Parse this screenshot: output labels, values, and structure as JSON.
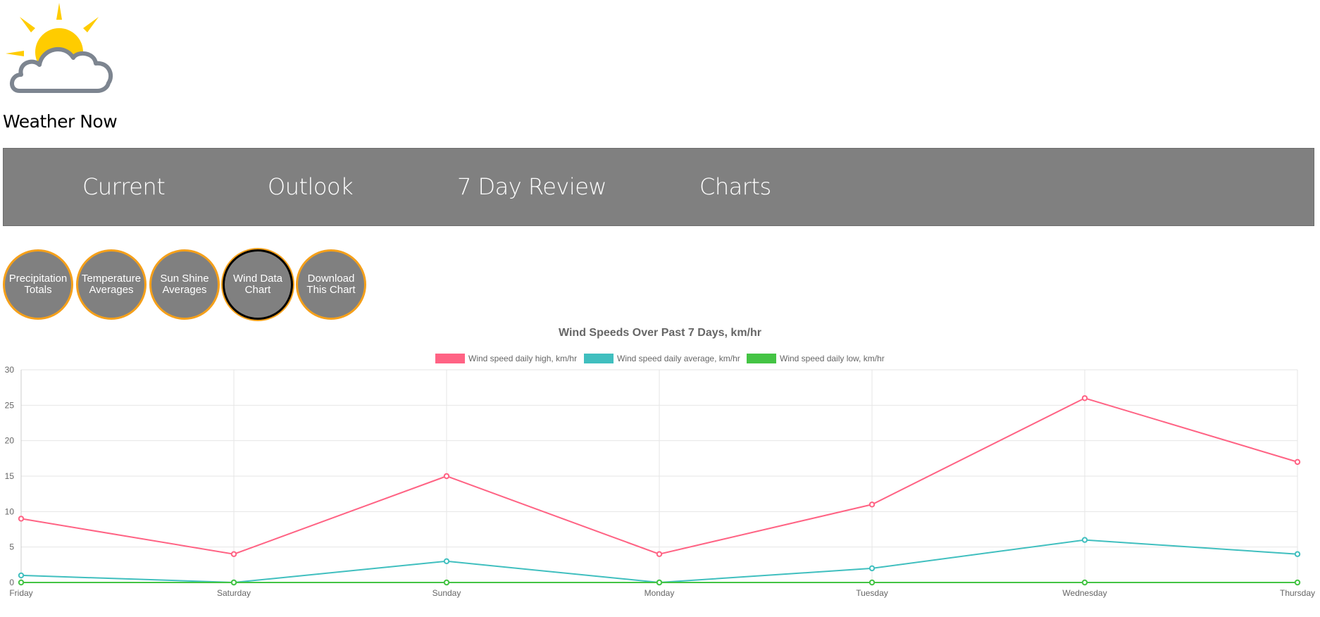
{
  "site": {
    "title": "Weather Now"
  },
  "logo": {
    "icon": "partly-cloudy-icon",
    "sun_color": "#ffcc00",
    "cloud_color": "#7d8590"
  },
  "nav": {
    "items": [
      {
        "label": "Current",
        "name": "nav-current"
      },
      {
        "label": "Outlook",
        "name": "nav-outlook"
      },
      {
        "label": "7 Day Review",
        "name": "nav-7-day-review"
      },
      {
        "label": "Charts",
        "name": "nav-charts"
      }
    ],
    "background": "#808080"
  },
  "chart_buttons": {
    "items": [
      {
        "label": "Precipitation Totals",
        "name": "precipitation-totals-button",
        "active": false
      },
      {
        "label": "Temperature Averages",
        "name": "temperature-averages-button",
        "active": false
      },
      {
        "label": "Sun Shine Averages",
        "name": "sun-shine-averages-button",
        "active": false
      },
      {
        "label": "Wind Data Chart",
        "name": "wind-data-chart-button",
        "active": true
      },
      {
        "label": "Download This Chart",
        "name": "download-chart-button",
        "active": false
      }
    ],
    "border_color": "#f5a01a"
  },
  "chart_data": {
    "type": "line",
    "title": "Wind Speeds Over Past 7 Days, km/hr",
    "categories": [
      "Friday",
      "Saturday",
      "Sunday",
      "Monday",
      "Tuesday",
      "Wednesday",
      "Thursday"
    ],
    "series": [
      {
        "name": "Wind speed daily high, km/hr",
        "color": "#ff6384",
        "values": [
          9,
          4,
          15,
          4,
          11,
          26,
          17
        ]
      },
      {
        "name": "Wind speed daily average, km/hr",
        "color": "#40bfbf",
        "values": [
          1,
          0,
          3,
          0,
          2,
          6,
          4
        ]
      },
      {
        "name": "Wind speed daily low, km/hr",
        "color": "#44c444",
        "values": [
          0,
          0,
          0,
          0,
          0,
          0,
          0
        ]
      }
    ],
    "yticks": [
      0,
      5,
      10,
      15,
      20,
      25,
      30
    ],
    "ylim": [
      0,
      30
    ],
    "grid": true,
    "legend_position": "top"
  }
}
